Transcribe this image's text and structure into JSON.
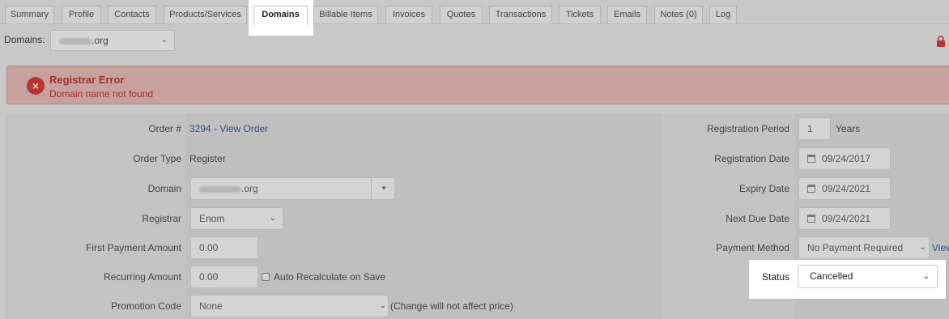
{
  "tabs": [
    {
      "label": "Summary"
    },
    {
      "label": "Profile"
    },
    {
      "label": "Contacts"
    },
    {
      "label": "Products/Services"
    },
    {
      "label": "Domains",
      "active": true
    },
    {
      "label": "Billable Items"
    },
    {
      "label": "Invoices"
    },
    {
      "label": "Quotes"
    },
    {
      "label": "Transactions"
    },
    {
      "label": "Tickets"
    },
    {
      "label": "Emails"
    },
    {
      "label": "Notes (0)"
    },
    {
      "label": "Log"
    }
  ],
  "domain_selector": {
    "label": "Domains:",
    "selected_suffix": ".org"
  },
  "error": {
    "title": "Registrar Error",
    "message": "Domain name not found"
  },
  "form": {
    "order": {
      "label": "Order #",
      "value": "3294 - View Order"
    },
    "order_type": {
      "label": "Order Type",
      "value": "Register"
    },
    "domain": {
      "label": "Domain",
      "value_suffix": ".org"
    },
    "registrar": {
      "label": "Registrar",
      "value": "Enom"
    },
    "first_payment": {
      "label": "First Payment Amount",
      "value": "0.00"
    },
    "recurring": {
      "label": "Recurring Amount",
      "value": "0.00",
      "auto_label": "Auto Recalculate on Save"
    },
    "promotion": {
      "label": "Promotion Code",
      "value": "None",
      "note": "(Change will not affect price)"
    },
    "registration_period": {
      "label": "Registration Period",
      "value": "1",
      "unit": "Years"
    },
    "registration_date": {
      "label": "Registration Date",
      "value": "09/24/2017"
    },
    "expiry_date": {
      "label": "Expiry Date",
      "value": "09/24/2021"
    },
    "next_due_date": {
      "label": "Next Due Date",
      "value": "09/24/2021"
    },
    "payment_method": {
      "label": "Payment Method",
      "value": "No Payment Required",
      "view_label": "View"
    },
    "status": {
      "label": "Status",
      "value": "Cancelled"
    }
  },
  "colors": {
    "overlay": "#c8c8c8",
    "error_text": "#a3312a",
    "error_bg": "#c6a19e",
    "link": "#3a4f86"
  }
}
